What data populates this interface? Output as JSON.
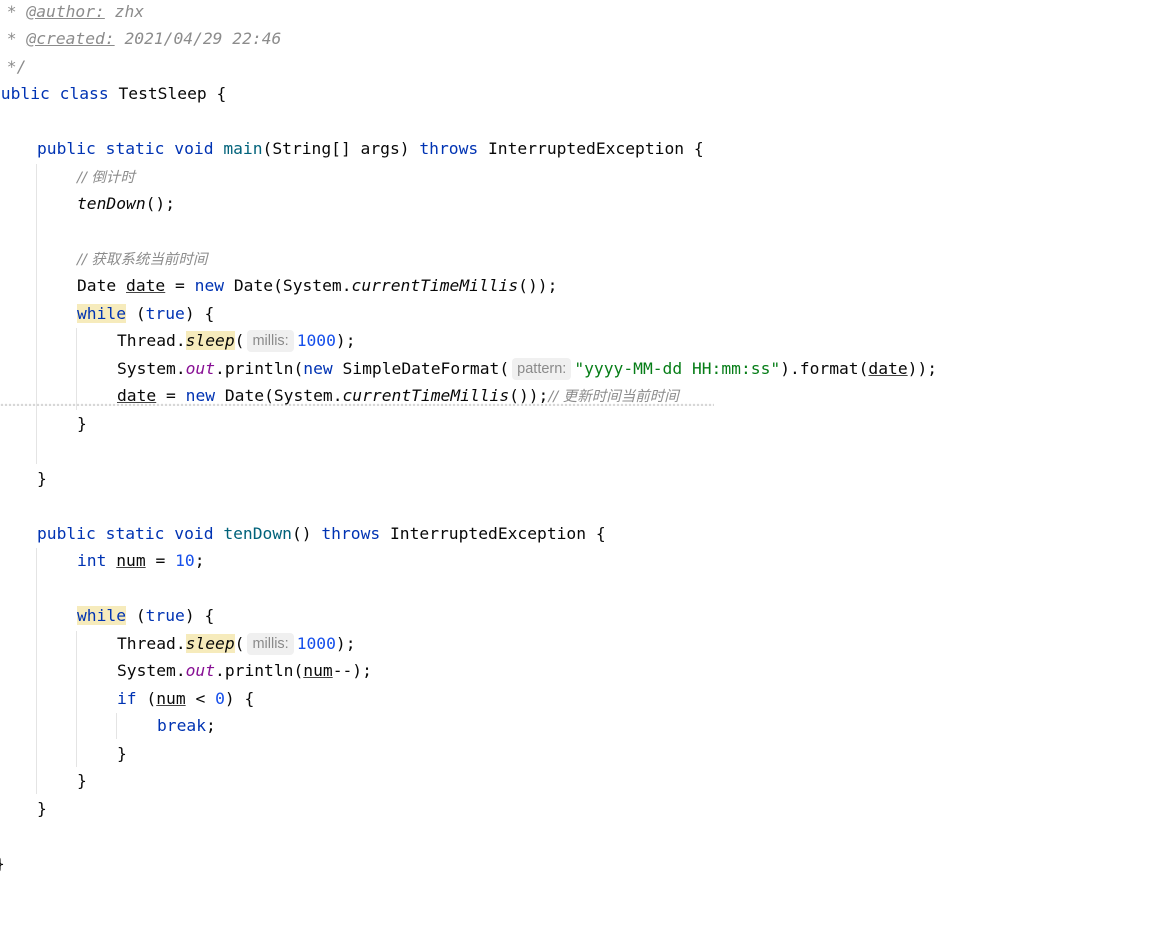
{
  "doc": {
    "author_prefix": " * ",
    "author_tag": "@author:",
    "author_value": " zhx",
    "created_prefix": " * ",
    "created_tag": "@created:",
    "created_value": " 2021/04/29 22:46",
    "end": " */"
  },
  "class_decl": {
    "kw1": "public",
    "kw2": "class",
    "name": "TestSleep",
    "brace": " {"
  },
  "main": {
    "sig_public": "public",
    "sig_static": "static",
    "sig_void": "void",
    "name": "main",
    "params": "(String[] args) ",
    "throws": "throws",
    "exception": " InterruptedException {",
    "comment1": "// 倒计时",
    "call_tendown": "tenDown",
    "call_tendown_tail": "();",
    "comment2": "// 获取系统当前时间",
    "date_type": "Date ",
    "date_var": "date",
    "date_eq": " = ",
    "new_kw": "new",
    "date_ctor": " Date(System.",
    "ctm": "currentTimeMillis",
    "date_tail": "());",
    "while_kw": "while",
    "while_open": " (",
    "true_kw": "true",
    "while_close": ") {",
    "thread": "Thread.",
    "sleep": "sleep",
    "paren_open": "(",
    "hint_millis": "millis:",
    "sleep_value": "1000",
    "sleep_tail": ");",
    "system": "System.",
    "out": "out",
    "println_open": ".println(",
    "sdf_new": "new",
    "sdf_ctor": " SimpleDateFormat(",
    "hint_pattern": "pattern:",
    "pattern_str": "\"yyyy-MM-dd HH:mm:ss\"",
    "format_open": ").format(",
    "format_var": "date",
    "format_tail": "));",
    "reassign_var": "date",
    "reassign_eq": " = ",
    "reassign_new": "new",
    "reassign_ctor": " Date(System.",
    "reassign_ctm": "currentTimeMillis",
    "reassign_tail": "());",
    "comment3": "// 更新时间当前时间",
    "close_while": "}",
    "close_method": "}"
  },
  "tendown": {
    "sig_public": "public",
    "sig_static": "static",
    "sig_void": "void",
    "name": "tenDown",
    "params": "() ",
    "throws": "throws",
    "exception": " InterruptedException {",
    "int_kw": "int",
    "num_var": "num",
    "num_eq": " = ",
    "num_value": "10",
    "num_semi": ";",
    "while_kw": "while",
    "while_open": " (",
    "true_kw": "true",
    "while_close": ") {",
    "thread": "Thread.",
    "sleep": "sleep",
    "paren_open": "(",
    "hint_millis": "millis:",
    "sleep_value": "1000",
    "sleep_tail": ");",
    "system": "System.",
    "out": "out",
    "println_open": ".println(",
    "println_var": "num",
    "println_tail": "--);",
    "if_kw": "if",
    "if_open": " (",
    "if_var": "num",
    "if_op": " < ",
    "if_value": "0",
    "if_close": ") {",
    "break_kw": "break",
    "break_semi": ";",
    "close_if": "}",
    "close_while": "}",
    "close_method": "}"
  },
  "class_close": "}"
}
